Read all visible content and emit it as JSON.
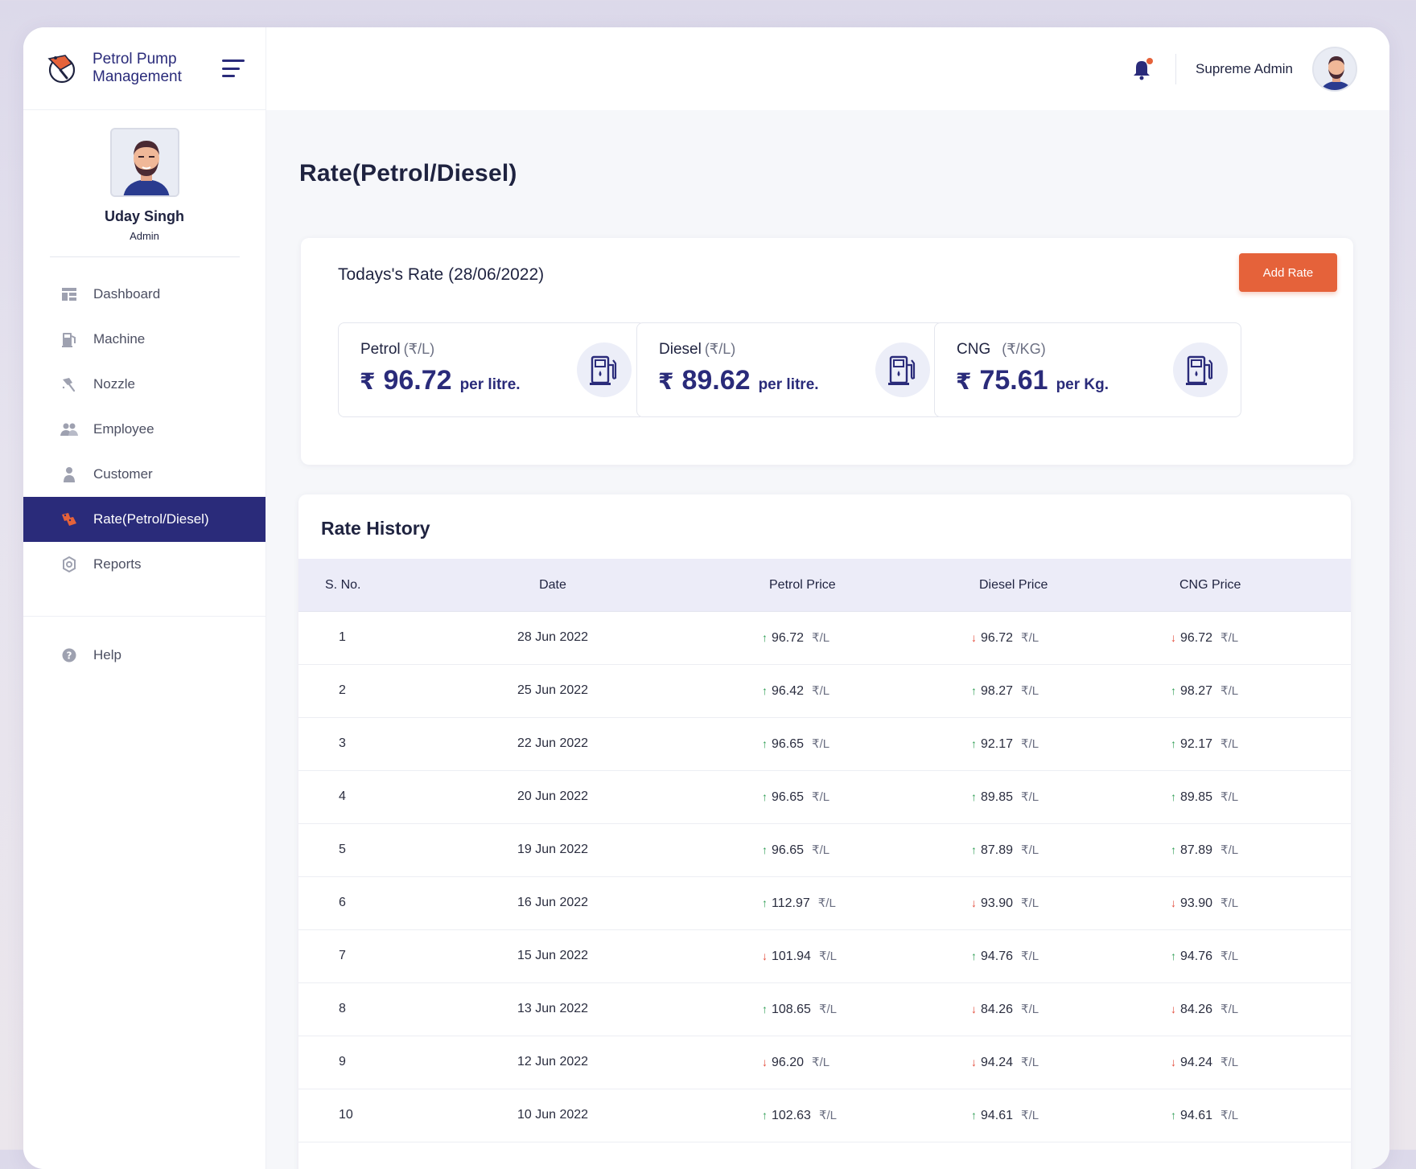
{
  "brand": {
    "title_line1": "Petrol Pump",
    "title_line2": "Management"
  },
  "profile": {
    "name": "Uday Singh",
    "role": "Admin"
  },
  "nav": [
    {
      "label": "Dashboard",
      "icon": "dashboard-icon"
    },
    {
      "label": "Machine",
      "icon": "fuel-machine-icon"
    },
    {
      "label": "Nozzle",
      "icon": "nozzle-icon"
    },
    {
      "label": "Employee",
      "icon": "employees-icon"
    },
    {
      "label": "Customer",
      "icon": "customer-icon"
    },
    {
      "label": "Rate(Petrol/Diesel)",
      "icon": "rate-tags-icon",
      "active": true
    },
    {
      "label": "Reports",
      "icon": "reports-gear-icon"
    }
  ],
  "nav_help": {
    "label": "Help",
    "icon": "help-icon"
  },
  "topbar": {
    "admin_name": "Supreme Admin"
  },
  "page": {
    "title": "Rate(Petrol/Diesel)"
  },
  "today": {
    "title": "Todays's Rate (28/06/2022)",
    "add_label": "Add Rate",
    "rates": [
      {
        "label": "Petrol",
        "unit": "(₹/L)",
        "currency": "₹",
        "value": "96.72",
        "per": "per litre."
      },
      {
        "label": "Diesel",
        "unit": "(₹/L)",
        "currency": "₹",
        "value": "89.62",
        "per": "per litre."
      },
      {
        "label": "CNG",
        "unit": "(₹/KG)",
        "currency": "₹",
        "value": "75.61",
        "per": "per Kg."
      }
    ]
  },
  "history": {
    "title": "Rate History",
    "columns": [
      "S. No.",
      "Date",
      "Petrol Price",
      "Diesel Price",
      "CNG Price"
    ],
    "unit": "₹/L",
    "rows": [
      {
        "sno": "1",
        "date": "28 Jun 2022",
        "petrol": "96.72",
        "petrol_dir": "up",
        "diesel": "96.72",
        "diesel_dir": "down",
        "cng": "96.72",
        "cng_dir": "down"
      },
      {
        "sno": "2",
        "date": "25 Jun 2022",
        "petrol": "96.42",
        "petrol_dir": "up",
        "diesel": "98.27",
        "diesel_dir": "up",
        "cng": "98.27",
        "cng_dir": "up"
      },
      {
        "sno": "3",
        "date": "22 Jun 2022",
        "petrol": "96.65",
        "petrol_dir": "up",
        "diesel": "92.17",
        "diesel_dir": "up",
        "cng": "92.17",
        "cng_dir": "up"
      },
      {
        "sno": "4",
        "date": "20 Jun 2022",
        "petrol": "96.65",
        "petrol_dir": "up",
        "diesel": "89.85",
        "diesel_dir": "up",
        "cng": "89.85",
        "cng_dir": "up"
      },
      {
        "sno": "5",
        "date": "19 Jun 2022",
        "petrol": "96.65",
        "petrol_dir": "up",
        "diesel": "87.89",
        "diesel_dir": "up",
        "cng": "87.89",
        "cng_dir": "up"
      },
      {
        "sno": "6",
        "date": "16 Jun 2022",
        "petrol": "112.97",
        "petrol_dir": "up",
        "diesel": "93.90",
        "diesel_dir": "down",
        "cng": "93.90",
        "cng_dir": "down"
      },
      {
        "sno": "7",
        "date": "15 Jun 2022",
        "petrol": "101.94",
        "petrol_dir": "down",
        "diesel": "94.76",
        "diesel_dir": "up",
        "cng": "94.76",
        "cng_dir": "up"
      },
      {
        "sno": "8",
        "date": "13 Jun 2022",
        "petrol": "108.65",
        "petrol_dir": "up",
        "diesel": "84.26",
        "diesel_dir": "down",
        "cng": "84.26",
        "cng_dir": "down"
      },
      {
        "sno": "9",
        "date": "12 Jun 2022",
        "petrol": "96.20",
        "petrol_dir": "down",
        "diesel": "94.24",
        "diesel_dir": "down",
        "cng": "94.24",
        "cng_dir": "down"
      },
      {
        "sno": "10",
        "date": "10 Jun 2022",
        "petrol": "102.63",
        "petrol_dir": "up",
        "diesel": "94.61",
        "diesel_dir": "up",
        "cng": "94.61",
        "cng_dir": "up"
      }
    ]
  },
  "colors": {
    "primary": "#2a2b7a",
    "accent": "#e5623a",
    "up": "#2f9e55",
    "down": "#e34c3c"
  }
}
